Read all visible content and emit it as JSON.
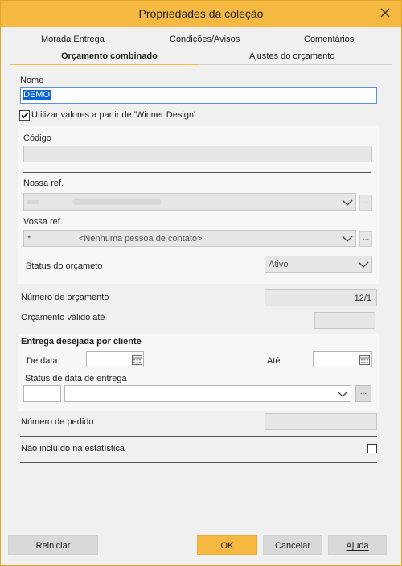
{
  "window": {
    "title": "Propriedades da coleção"
  },
  "tabs_row1": [
    "Morada Entrega",
    "Condições/Avisos",
    "Comentários"
  ],
  "tabs_row2": [
    "Orçamento combinado",
    "Ajustes do orçamento"
  ],
  "form": {
    "nome_label": "Nome",
    "nome_value": "DEMO",
    "utilizar_label": "Utilizar valores a partir de 'Winner Design'",
    "utilizar_checked": true,
    "codigo_label": "Código",
    "nossa_ref_label": "Nossa ref.",
    "vossa_ref_label": "Vossa ref.",
    "vossa_ref_prefix": "*",
    "vossa_ref_value": "<Nenhuma pessoa de contato>",
    "status_label": "Status do orçameto",
    "status_value": "Ativo",
    "numero_label": "Número de orçamento",
    "numero_value": "12/1",
    "valido_label": "Orçamento válido até",
    "entrega_title": "Entrega desejada por cliente",
    "de_data_label": "De data",
    "ate_label": "Até",
    "status_entrega_label": "Status de data de entrega",
    "numero_pedido_label": "Número de pedido",
    "nao_incluido_label": "Não incluído na estatística",
    "nao_incluido_checked": false
  },
  "footer": {
    "reiniciar": "Reiniciar",
    "ok": "OK",
    "cancelar": "Cancelar",
    "ajuda": "Ajuda"
  },
  "colors": {
    "accent": "#f5b942",
    "background": "#f0f0f0",
    "selection": "#0a64d8"
  }
}
